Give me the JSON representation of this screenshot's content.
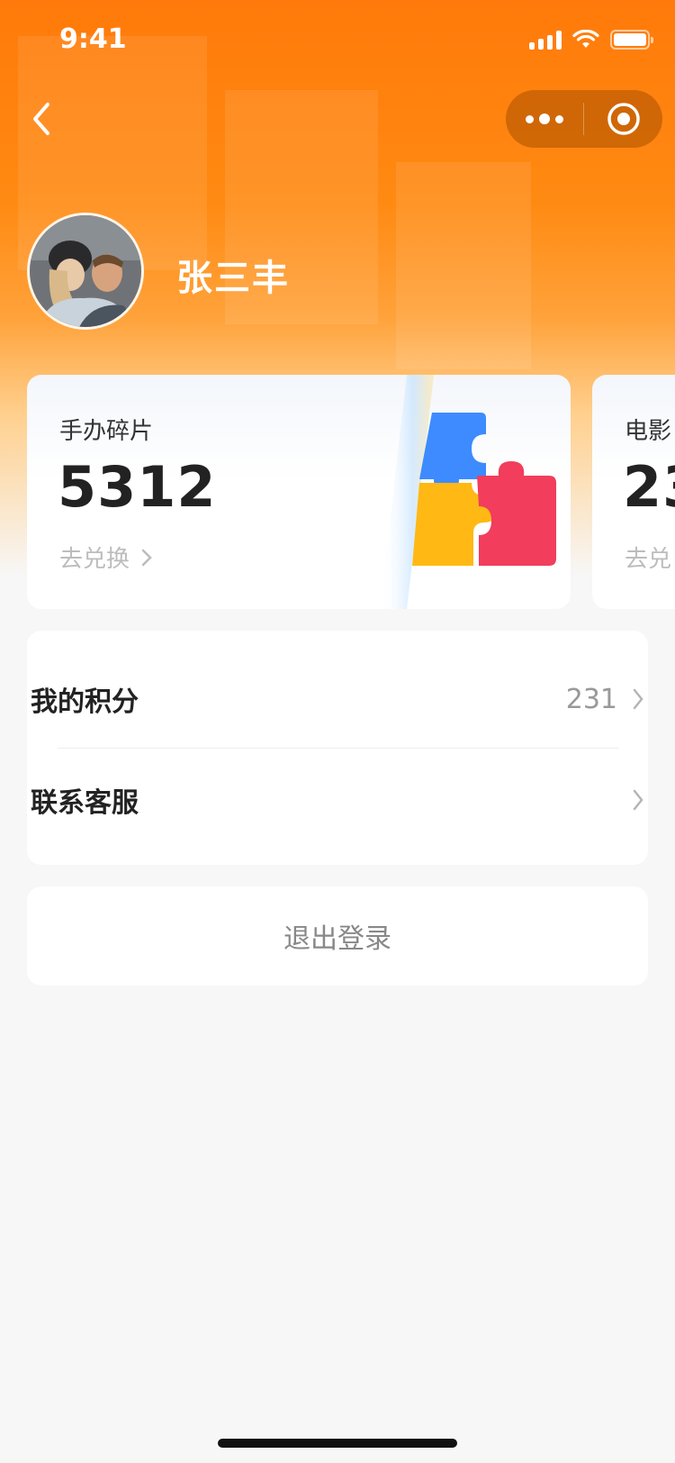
{
  "status_bar": {
    "time": "9:41"
  },
  "nav": {
    "back_icon": "chevron-left-icon",
    "more_icon": "more-dots-icon",
    "close_icon": "target-circle-icon"
  },
  "profile": {
    "avatar": "avatar-photo",
    "name": "张三丰"
  },
  "cards": [
    {
      "title": "手办碎片",
      "value": "5312",
      "action": "去兑换",
      "icon": "puzzle-icon"
    },
    {
      "title": "电影",
      "value": "23",
      "action": "去兑"
    }
  ],
  "menu": {
    "points": {
      "label": "我的积分",
      "value": "231"
    },
    "service": {
      "label": "联系客服"
    }
  },
  "logout": {
    "label": "退出登录"
  },
  "colors": {
    "brand_orange": "#ff7a0a",
    "background": "#f7f7f7"
  }
}
